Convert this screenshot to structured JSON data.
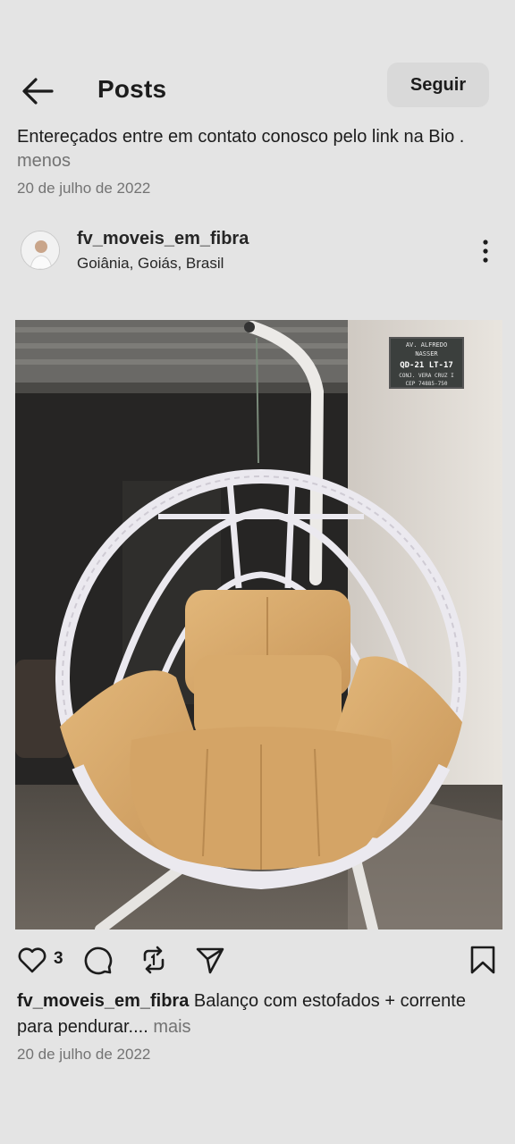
{
  "header": {
    "title": "Posts",
    "follow_label": "Seguir"
  },
  "top_caption": {
    "text": "Entereçados entre em contato  conosco pelo link  na Bio . ",
    "less_label": "menos"
  },
  "top_date": "20 de julho de 2022",
  "author": {
    "username": "fv_moveis_em_fibra",
    "location": "Goiânia, Goiás, Brasil"
  },
  "post_image": {
    "plate_lines": [
      "AV. ALFREDO",
      "NASSER",
      "QD-21   LT-17",
      "CONJ. VERA CRUZ I",
      "CEP 74885-750"
    ]
  },
  "actions": {
    "like_count": "3",
    "icons": [
      "heart-icon",
      "comment-icon",
      "repost-icon",
      "send-icon",
      "bookmark-icon"
    ]
  },
  "bottom_caption": {
    "username": "fv_moveis_em_fibra",
    "text": " Balanço com estofados + corrente para pendurar.... ",
    "more_label": "mais"
  },
  "bottom_date": "20 de julho de 2022",
  "colors": {
    "background": "#e4e4e4",
    "follow_button": "#d9d9d9",
    "muted_text": "#737373",
    "cushion": "#d6a86a"
  }
}
